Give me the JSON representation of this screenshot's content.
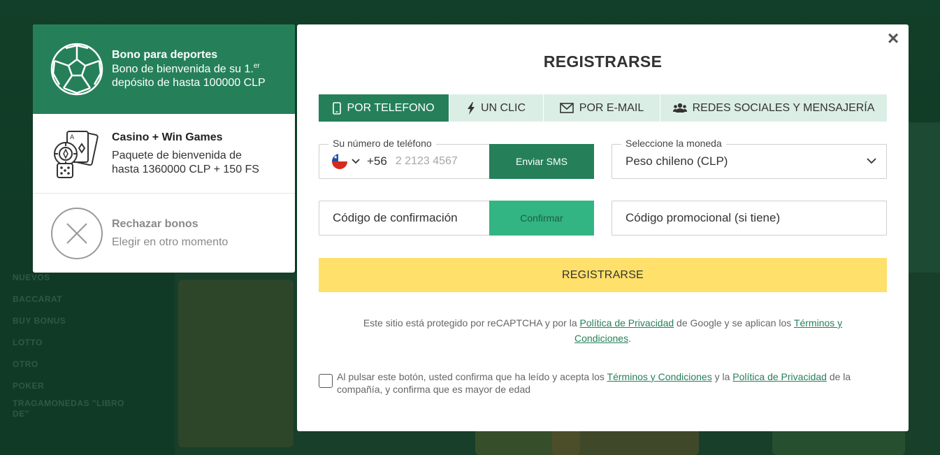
{
  "background": {
    "categories": [
      "NUEVOS",
      "BACCARAT",
      "BUY BONUS",
      "LOTTO",
      "OTRO",
      "POKER",
      "TRAGAMONEDAS \"LIBRO DE\""
    ]
  },
  "bonus_panel": {
    "sport": {
      "title": "Bono para deportes",
      "desc_a": "Bono de bienvenida de su 1.",
      "desc_sup": "er",
      "desc_b": " depósito de hasta 100000 CLP"
    },
    "casino": {
      "title": "Casino + Win Games",
      "desc": "Paquete de bienvenida de hasta 1360000 CLP + 150 FS"
    },
    "reject": {
      "title": "Rechazar bonos",
      "desc": "Elegir en otro momento"
    }
  },
  "modal": {
    "title": "REGISTRARSE",
    "close_symbol": "×",
    "tabs": [
      {
        "label": "POR TELEFONO",
        "icon": "phone-icon",
        "active": true
      },
      {
        "label": "UN CLIC",
        "icon": "lightning-icon",
        "active": false
      },
      {
        "label": "POR E-MAIL",
        "icon": "envelope-icon",
        "active": false
      },
      {
        "label": "REDES SOCIALES Y MENSAJERÍA",
        "icon": "users-icon",
        "active": false
      }
    ],
    "phone": {
      "label": "Su número de teléfono",
      "country_code": "+56",
      "placeholder": "2 2123 4567",
      "value": "",
      "send_sms_label": "Enviar SMS"
    },
    "currency": {
      "label": "Seleccione la moneda",
      "selected": "Peso chileno (CLP)"
    },
    "confirmation": {
      "placeholder": "Código de confirmación",
      "confirm_label": "Confirmar"
    },
    "promo": {
      "placeholder": "Código promocional (si tiene)"
    },
    "register_label": "REGISTRARSE",
    "recaptcha": {
      "text_1": "Este sitio está protegido por reCAPTCHA y por la ",
      "privacy_link": "Política de Privacidad",
      "text_2": " de Google y se aplican los ",
      "terms_link": "Términos y Condiciones",
      "text_3": "."
    },
    "consent": {
      "text_1": "Al pulsar este botón, usted confirma que ha leído y acepta los ",
      "terms_link": "Términos y Condiciones",
      "text_2": " y la ",
      "privacy_link": "Política de Privacidad",
      "text_3": " de la compañía, y confirma que es mayor de edad",
      "checked": false
    }
  },
  "colors": {
    "brand_green": "#25805a",
    "light_green_button": "#33b583",
    "tab_bg": "#dbeee6",
    "register_yellow": "#ffe06b"
  }
}
